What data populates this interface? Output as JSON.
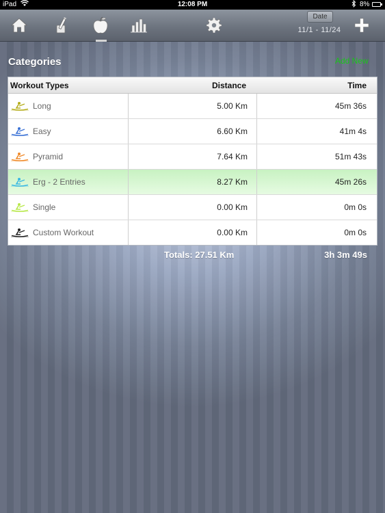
{
  "status_bar": {
    "device": "iPad",
    "time": "12:08 PM",
    "battery": "8%"
  },
  "toolbar": {
    "icons": [
      "home-icon",
      "pencil-icon",
      "apple-icon",
      "bar-chart-icon",
      "gear-icon",
      "plus-icon"
    ],
    "date_label": "Date",
    "date_range": "11/1 - 11/24"
  },
  "page": {
    "title": "Categories",
    "add_new_label": "Add New"
  },
  "table": {
    "headers": {
      "type": "Workout Types",
      "distance": "Distance",
      "time": "Time"
    },
    "rows": [
      {
        "label": "Long",
        "distance": "5.00 Km",
        "time": "45m 36s",
        "color": "#b5ad1c"
      },
      {
        "label": "Easy",
        "distance": "6.60 Km",
        "time": "41m 4s",
        "color": "#3b72d6"
      },
      {
        "label": "Pyramid",
        "distance": "7.64 Km",
        "time": "51m 43s",
        "color": "#f08a2a"
      },
      {
        "label": "Erg - 2 Entries",
        "distance": "8.27 Km",
        "time": "45m 26s",
        "color": "#38b8e3"
      },
      {
        "label": "Single",
        "distance": "0.00 Km",
        "time": "0m 0s",
        "color": "#b8e84a"
      },
      {
        "label": "Custom Workout",
        "distance": "0.00 Km",
        "time": "0m 0s",
        "color": "#222222"
      }
    ],
    "selected_row": 3
  },
  "totals": {
    "distance": "Totals: 27.51 Km",
    "time": "3h 3m 49s"
  },
  "colors": {
    "add_new": "#19c619",
    "selected_row": "#d5f7cf"
  }
}
